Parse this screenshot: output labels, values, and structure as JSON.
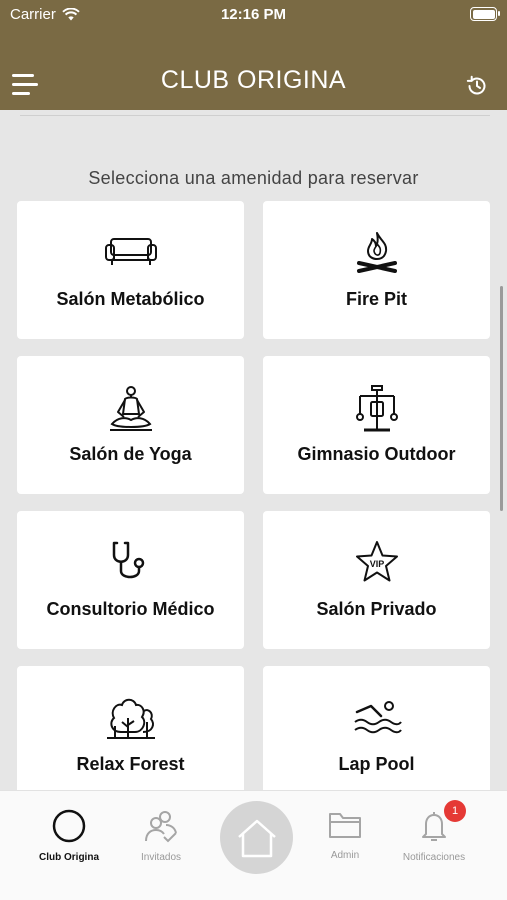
{
  "status_bar": {
    "carrier": "Carrier",
    "time": "12:16 PM"
  },
  "header": {
    "title": "CLUB ORIGINA",
    "menu_icon": "hamburger-icon",
    "history_icon": "history-icon"
  },
  "main": {
    "subtitle": "Selecciona una amenidad para reservar",
    "amenities": [
      {
        "label": "Salón Metabólico",
        "icon": "sofa-icon"
      },
      {
        "label": "Fire Pit",
        "icon": "campfire-icon"
      },
      {
        "label": "Salón de Yoga",
        "icon": "yoga-icon"
      },
      {
        "label": "Gimnasio Outdoor",
        "icon": "gym-machine-icon"
      },
      {
        "label": "Consultorio Médico",
        "icon": "stethoscope-icon"
      },
      {
        "label": "Salón Privado",
        "icon": "vip-star-icon",
        "icon_text": "VIP"
      },
      {
        "label": "Relax Forest",
        "icon": "trees-icon"
      },
      {
        "label": "Lap Pool",
        "icon": "swimmer-icon"
      }
    ]
  },
  "tab_bar": {
    "tabs": [
      {
        "label": "Club Origina",
        "icon": "circle-icon",
        "active": true
      },
      {
        "label": "Invitados",
        "icon": "guests-icon",
        "active": false
      },
      {
        "label": "",
        "icon": "home-icon",
        "active": false
      },
      {
        "label": "Admin",
        "icon": "folder-icon",
        "active": false
      },
      {
        "label": "Notificaciones",
        "icon": "bell-icon",
        "active": false
      }
    ],
    "notification_count": "1"
  },
  "colors": {
    "header_bg": "#7a6a44",
    "badge": "#e53935",
    "page_bg": "#e6e6e6"
  }
}
